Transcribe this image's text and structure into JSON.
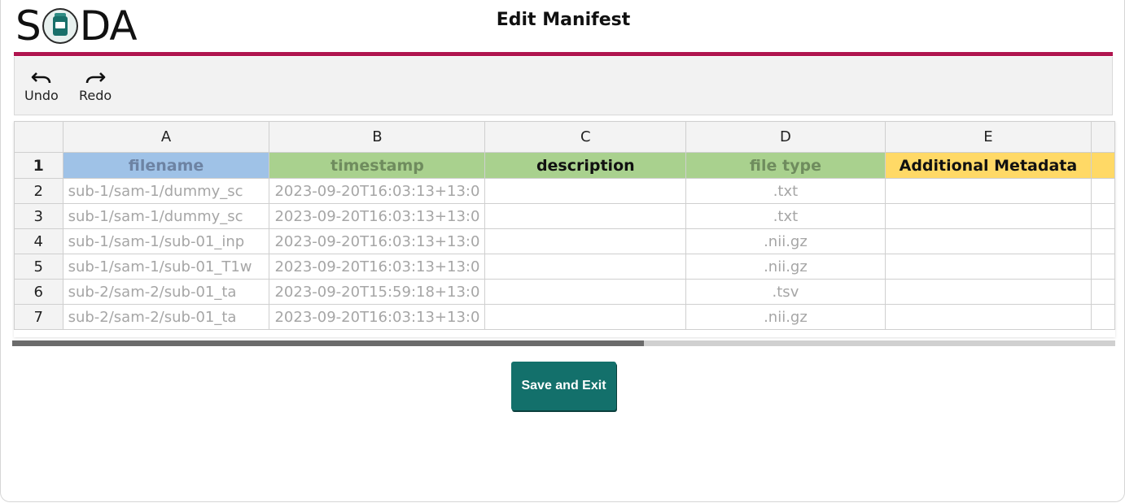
{
  "logo": {
    "text_left": "S",
    "text_right": "DA",
    "alt": "SODA"
  },
  "page": {
    "title": "Edit Manifest"
  },
  "colors": {
    "accent_bar": "#b0154f",
    "save_button": "#13706b",
    "header_filename": "#9fc2e7",
    "header_green": "#a9d18e",
    "header_additional": "#ffd966"
  },
  "toolbar": {
    "undo_label": "Undo",
    "redo_label": "Redo"
  },
  "grid": {
    "column_letters": [
      "A",
      "B",
      "C",
      "D",
      "E"
    ],
    "header_row": {
      "index": "1",
      "cells": [
        "filename",
        "timestamp",
        "description",
        "file type",
        "Additional Metadata"
      ]
    },
    "rows": [
      {
        "index": "2",
        "filename": "sub-1/sam-1/dummy_sc",
        "timestamp": "2023-09-20T16:03:13+13:0",
        "description": "",
        "file_type": ".txt",
        "additional": ""
      },
      {
        "index": "3",
        "filename": "sub-1/sam-1/dummy_sc",
        "timestamp": "2023-09-20T16:03:13+13:0",
        "description": "",
        "file_type": ".txt",
        "additional": ""
      },
      {
        "index": "4",
        "filename": "sub-1/sam-1/sub-01_inp",
        "timestamp": "2023-09-20T16:03:13+13:0",
        "description": "",
        "file_type": ".nii.gz",
        "additional": ""
      },
      {
        "index": "5",
        "filename": "sub-1/sam-1/sub-01_T1w",
        "timestamp": "2023-09-20T16:03:13+13:0",
        "description": "",
        "file_type": ".nii.gz",
        "additional": ""
      },
      {
        "index": "6",
        "filename": "sub-2/sam-2/sub-01_ta",
        "timestamp": "2023-09-20T15:59:18+13:0",
        "description": "",
        "file_type": ".tsv",
        "additional": ""
      },
      {
        "index": "7",
        "filename": "sub-2/sam-2/sub-01_ta",
        "timestamp": "2023-09-20T16:03:13+13:0",
        "description": "",
        "file_type": ".nii.gz",
        "additional": ""
      }
    ],
    "horizontal_scroll_fraction": 0.57
  },
  "actions": {
    "save_label": "Save and Exit"
  }
}
